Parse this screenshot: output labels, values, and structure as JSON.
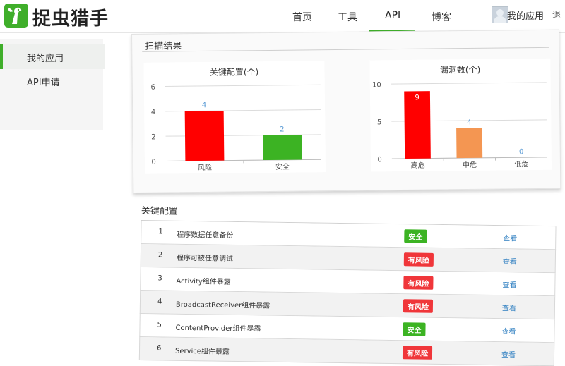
{
  "header": {
    "brand": "捉虫猎手",
    "nav": [
      "首页",
      "工具",
      "API",
      "博客"
    ],
    "user_label": "我的应用",
    "exit_label": "退"
  },
  "sidebar": {
    "items": [
      {
        "label": "我的应用",
        "active": true
      },
      {
        "label": "API申请",
        "active": false
      }
    ]
  },
  "scan_results": {
    "title": "扫描结果"
  },
  "chart_data": [
    {
      "type": "bar",
      "title": "关键配置(个)",
      "categories": [
        "风险",
        "安全"
      ],
      "values": [
        4,
        2
      ],
      "colors": [
        "#ff0000",
        "#3cb323"
      ],
      "ylim": [
        0,
        6
      ],
      "yticks": [
        0,
        2,
        4,
        6
      ],
      "grid": true
    },
    {
      "type": "bar",
      "title": "漏洞数(个)",
      "categories": [
        "高危",
        "中危",
        "低危"
      ],
      "values": [
        9,
        4,
        0
      ],
      "colors": [
        "#ff0000",
        "#f49652",
        "#3cb323"
      ],
      "ylim": [
        0,
        10
      ],
      "yticks": [
        0,
        5,
        10
      ],
      "grid": true
    }
  ],
  "key_config": {
    "title": "关键配置",
    "link_label": "查看",
    "rows": [
      {
        "index": "1",
        "name": "程序数据任意备份",
        "status": "安全",
        "color": "#3cb323"
      },
      {
        "index": "2",
        "name": "程序可被任意调试",
        "status": "有风险",
        "color": "#f0363a"
      },
      {
        "index": "3",
        "name": "Activity组件暴露",
        "status": "有风险",
        "color": "#f0363a"
      },
      {
        "index": "4",
        "name": "BroadcastReceiver组件暴露",
        "status": "有风险",
        "color": "#f0363a"
      },
      {
        "index": "5",
        "name": "ContentProvider组件暴露",
        "status": "安全",
        "color": "#3cb323"
      },
      {
        "index": "6",
        "name": "Service组件暴露",
        "status": "有风险",
        "color": "#f0363a"
      }
    ]
  }
}
